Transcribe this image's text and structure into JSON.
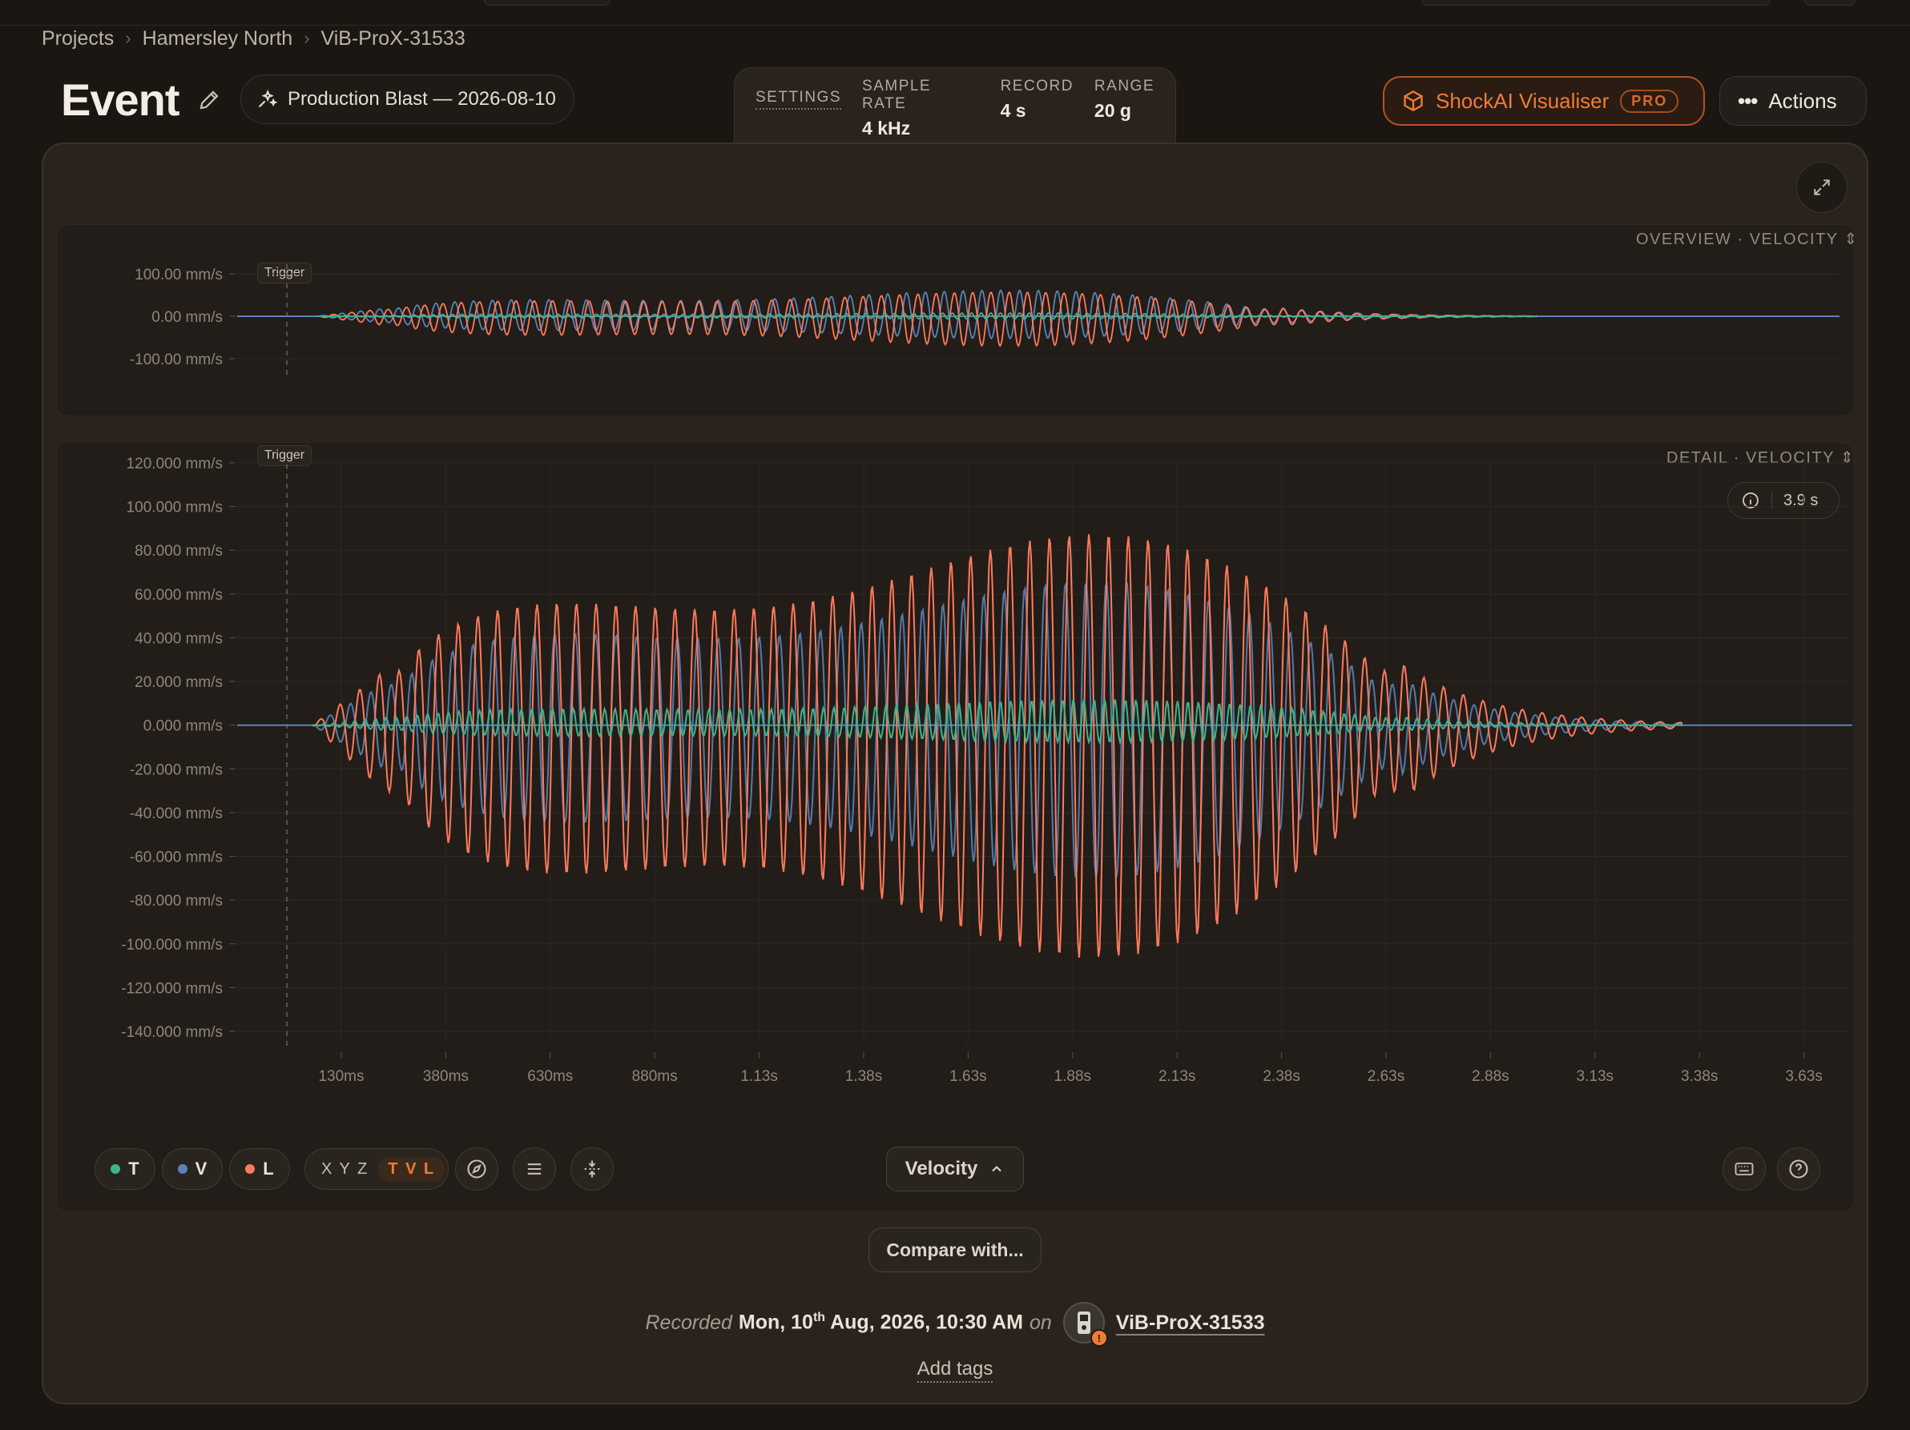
{
  "breadcrumb": [
    "Projects",
    "Hamersley North",
    "ViB-ProX-31533"
  ],
  "page": {
    "title": "Event",
    "event_name": "Production Blast — 2026-08-10"
  },
  "settings": {
    "link_label": "SETTINGS",
    "items": [
      {
        "label": "SAMPLE RATE",
        "value": "4 kHz"
      },
      {
        "label": "RECORD",
        "value": "4 s"
      },
      {
        "label": "RANGE",
        "value": "20 g"
      }
    ]
  },
  "header_actions": {
    "shockai_label": "ShockAI Visualiser",
    "pro_badge": "PRO",
    "actions_label": "Actions"
  },
  "overview_chart": {
    "label": "OVERVIEW · VELOCITY",
    "trigger_label": "Trigger",
    "y_ticks": [
      "100.00 mm/s",
      "0.00 mm/s",
      "-100.00 mm/s"
    ]
  },
  "detail_chart": {
    "label": "DETAIL · VELOCITY",
    "trigger_label": "Trigger",
    "duration": "3.9 s",
    "y_ticks": [
      "120.000 mm/s",
      "100.000 mm/s",
      "80.000 mm/s",
      "60.000 mm/s",
      "40.000 mm/s",
      "20.000 mm/s",
      "0.000 mm/s",
      "-20.000 mm/s",
      "-40.000 mm/s",
      "-60.000 mm/s",
      "-80.000 mm/s",
      "-100.000 mm/s",
      "-120.000 mm/s",
      "-140.000 mm/s"
    ],
    "x_ticks": [
      "130ms",
      "380ms",
      "630ms",
      "880ms",
      "1.13s",
      "1.38s",
      "1.63s",
      "1.88s",
      "2.13s",
      "2.38s",
      "2.63s",
      "2.88s",
      "3.13s",
      "3.38s",
      "3.63s"
    ]
  },
  "chart_data": {
    "type": "line",
    "ylabel": "",
    "xlabel": "",
    "ylim": [
      -140,
      120
    ],
    "series": [
      {
        "name": "L",
        "color": "#ff7a5c",
        "peak_positive": 100,
        "peak_negative": -122
      },
      {
        "name": "V",
        "color": "#5b83b8",
        "peak_positive": 75,
        "peak_negative": -80
      },
      {
        "name": "T",
        "color": "#3fb38d",
        "peak_positive": 15,
        "peak_negative": -10
      }
    ]
  },
  "toolbar": {
    "channels": [
      {
        "label": "T",
        "color": "#3fb38d"
      },
      {
        "label": "V",
        "color": "#5b83b8"
      },
      {
        "label": "L",
        "color": "#ff7a5c"
      }
    ],
    "axis_xyz": "X Y Z",
    "axis_tvl": "T V L",
    "velocity_label": "Velocity",
    "compare_label": "Compare with..."
  },
  "footer": {
    "recorded_word": "Recorded",
    "date_day": "Mon, 10",
    "date_sup": "th",
    "date_rest": "Aug, 2026, 10:30 AM",
    "on_word": "on",
    "device": "ViB-ProX-31533",
    "add_tags": "Add tags"
  }
}
